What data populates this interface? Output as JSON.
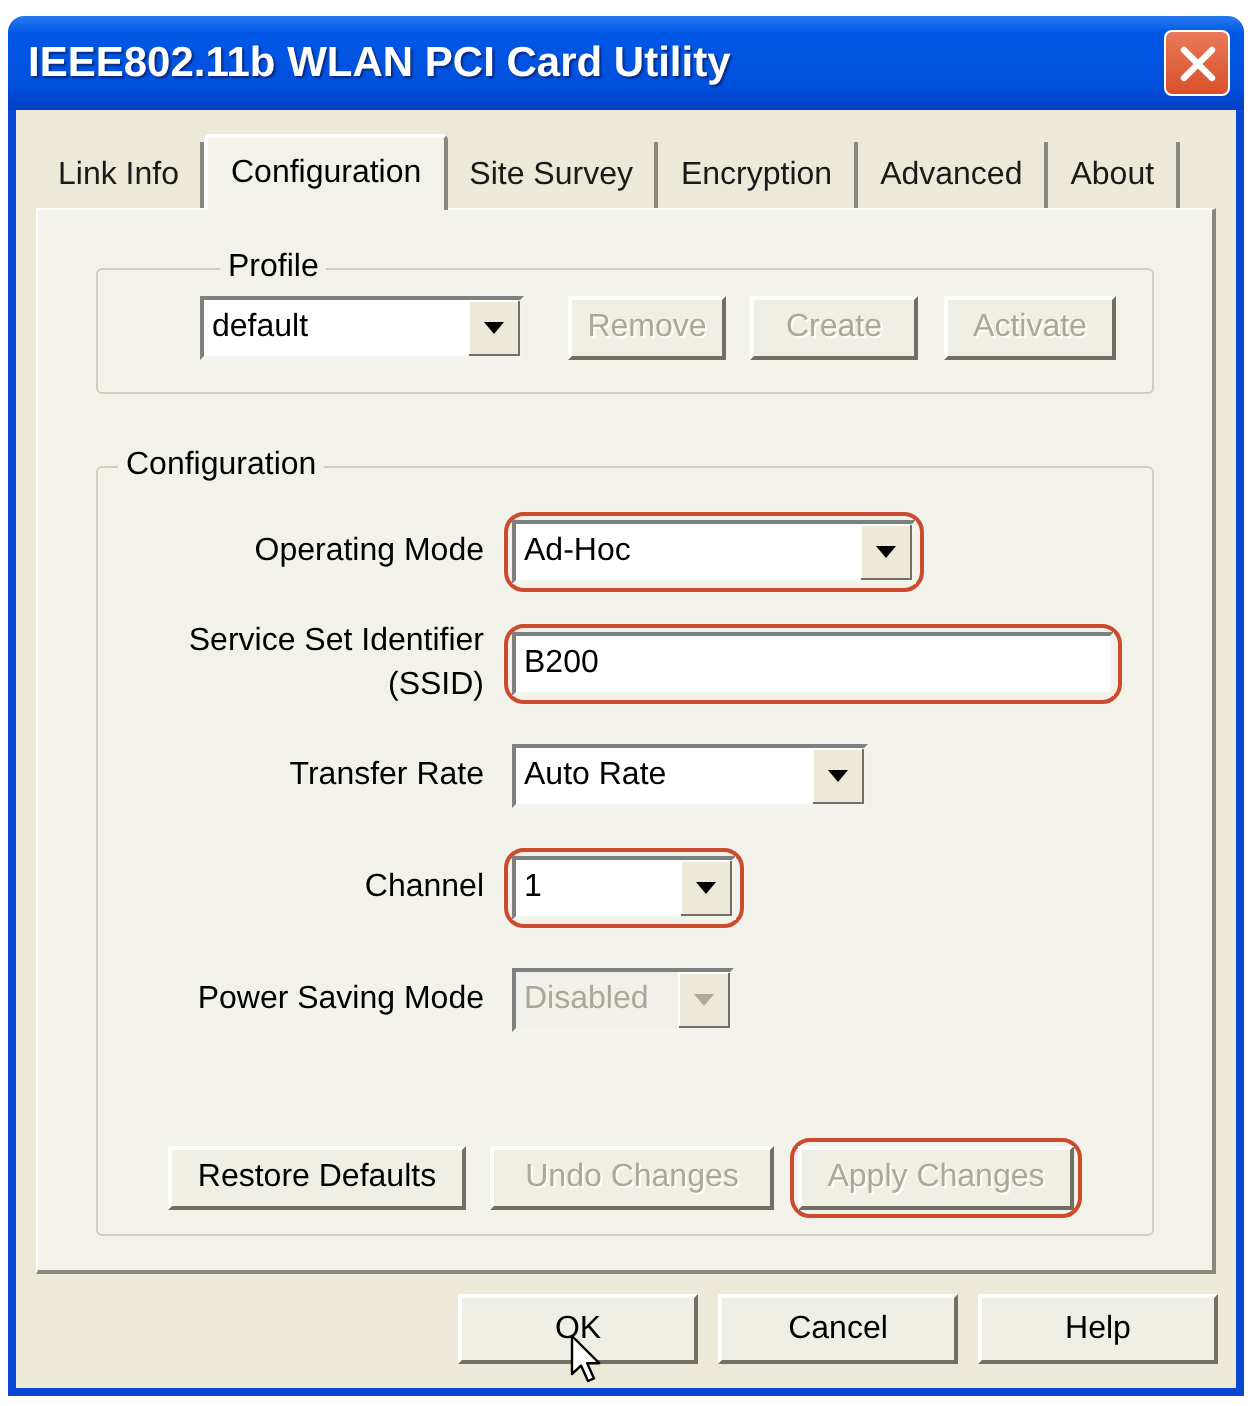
{
  "window": {
    "title": "IEEE802.11b WLAN PCI Card Utility"
  },
  "tabs": [
    {
      "label": "Link Info",
      "selected": false
    },
    {
      "label": "Configuration",
      "selected": true
    },
    {
      "label": "Site Survey",
      "selected": false
    },
    {
      "label": "Encryption",
      "selected": false
    },
    {
      "label": "Advanced",
      "selected": false
    },
    {
      "label": "About",
      "selected": false
    }
  ],
  "profile": {
    "title": "Profile",
    "value": "default",
    "buttons": [
      {
        "label": "Remove",
        "disabled": true
      },
      {
        "label": "Create",
        "disabled": true
      },
      {
        "label": "Activate",
        "disabled": true
      }
    ]
  },
  "configuration": {
    "title": "Configuration",
    "fields": [
      {
        "kind": "dropdown",
        "label": "Operating Mode",
        "value": "Ad-Hoc",
        "disabled": false,
        "highlighted": true
      },
      {
        "kind": "text",
        "label": "Service Set Identifier (SSID)",
        "value": "B200",
        "disabled": false,
        "highlighted": true
      },
      {
        "kind": "dropdown",
        "label": "Transfer Rate",
        "value": "Auto Rate",
        "disabled": false,
        "highlighted": false
      },
      {
        "kind": "dropdown",
        "label": "Channel",
        "value": "1",
        "disabled": false,
        "highlighted": true
      },
      {
        "kind": "dropdown",
        "label": "Power Saving Mode",
        "value": "Disabled",
        "disabled": true,
        "highlighted": false
      }
    ],
    "buttons": [
      {
        "label": "Restore Defaults",
        "disabled": false,
        "highlighted": false
      },
      {
        "label": "Undo Changes",
        "disabled": true,
        "highlighted": false
      },
      {
        "label": "Apply Changes",
        "disabled": true,
        "highlighted": true
      }
    ]
  },
  "dialog_buttons": [
    {
      "label": "OK",
      "pointer_over": true
    },
    {
      "label": "Cancel",
      "pointer_over": false
    },
    {
      "label": "Help",
      "pointer_over": false
    }
  ]
}
